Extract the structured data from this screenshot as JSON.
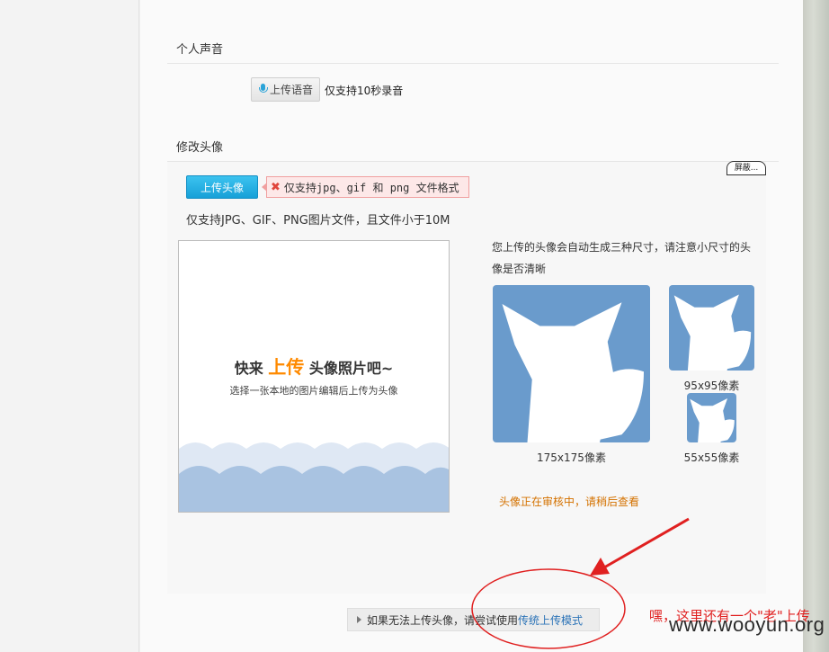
{
  "voice": {
    "title": "个人声音",
    "button_label": "上传语音",
    "note": "仅支持10秒录音"
  },
  "avatar": {
    "title": "修改头像",
    "shield_label": "屏蔽...",
    "upload_label": "上传头像",
    "error_tip": "仅支持jpg、gif 和 png 文件格式",
    "format_note": "仅支持JPG、GIF、PNG图片文件，且文件小于10M",
    "prompt_pre": "快来",
    "prompt_highlight": "上传",
    "prompt_post": "头像照片吧~",
    "prompt_sub": "选择一张本地的图片编辑后上传为头像",
    "size_note": "您上传的头像会自动生成三种尺寸，请注意小尺寸的头像是否清晰",
    "sizes": [
      "175x175像素",
      "95x95像素",
      "55x55像素"
    ],
    "review_status": "头像正在审核中，请稍后查看"
  },
  "legacy": {
    "text": "如果无法上传头像，请尝试使用",
    "link": "传统上传模式"
  },
  "annotation": {
    "text": "嘿，这里还有一个\"老\"上传"
  },
  "watermark": "www.wooyun.org",
  "colors": {
    "upload_button": "#1aa4dc",
    "highlight": "#ff8a00",
    "thumb_bg": "#6a9bcc",
    "review_text": "#d47200",
    "annotation": "#e02020",
    "link": "#2b73b7"
  }
}
